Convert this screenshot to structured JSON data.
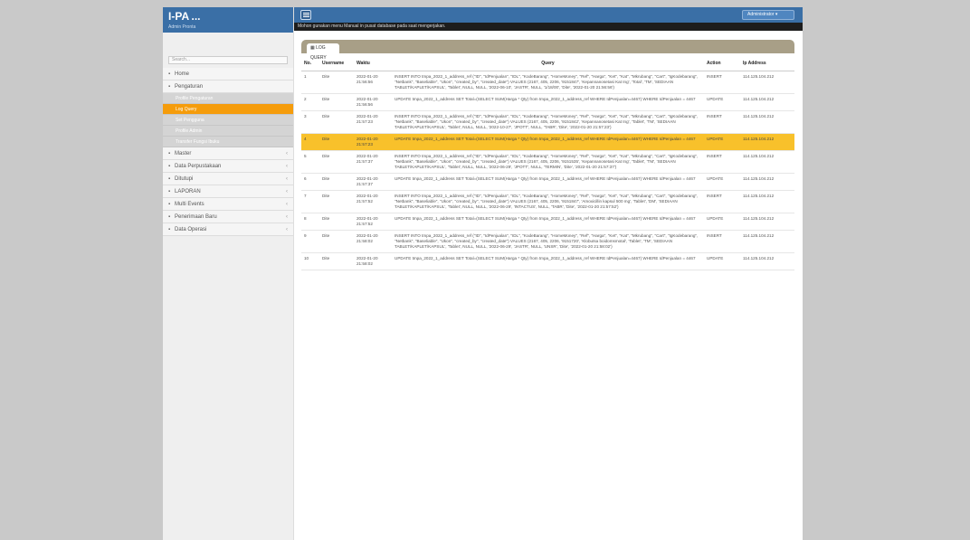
{
  "brand": {
    "title": "I-PA ...",
    "subtitle": "Admin Pronta"
  },
  "sidebar": {
    "search": "Search...",
    "items": [
      {
        "label": "Home",
        "icon": "home-icon",
        "chev": ""
      },
      {
        "label": "Pengaturan",
        "icon": "settings-icon",
        "chev": ""
      }
    ],
    "subitems": [
      {
        "label": "Profile Pengaturan",
        "active": false
      },
      {
        "label": "Log Query",
        "active": true
      },
      {
        "label": "Set Pengguna",
        "active": false
      },
      {
        "label": "Profile Admin",
        "active": false
      },
      {
        "label": "Transfer Fungsi Ibuku",
        "active": false
      }
    ],
    "items2": [
      {
        "label": "Master",
        "icon": "folder-icon",
        "chev": "‹"
      },
      {
        "label": "Data Perpustakaan",
        "icon": "folder-icon",
        "chev": "‹"
      },
      {
        "label": "Ditutupi",
        "icon": "folder-icon",
        "chev": "‹"
      },
      {
        "label": "LAPORAN",
        "icon": "folder-icon",
        "chev": "‹"
      },
      {
        "label": "Multi Events",
        "icon": "folder-icon",
        "chev": "‹"
      },
      {
        "label": "Penerimaan Baru",
        "icon": "folder-icon",
        "chev": "‹"
      },
      {
        "label": "Data Operasi",
        "icon": "folder-icon",
        "chev": "‹"
      }
    ]
  },
  "topbar": {
    "user": "Administrator"
  },
  "notice": "Mohon gunakan menu Manual in pusat database pada saat mengerjakan.",
  "tab": {
    "label": "LOG QUERY"
  },
  "table": {
    "headers": [
      "No.",
      "Username",
      "Waktu",
      "Query",
      "Action",
      "Ip Address"
    ],
    "rows": [
      {
        "no": "1",
        "user": "Dite",
        "time": "2022-01-20 21:56:56",
        "query": "INSERT INTO tmpa_2022_1_address_ref (\"ID\", \"IdPenjualan\", \"IDL\", \"KodeBarang\", \"HomeMoney\", \"Ref\", \"Harga\", \"Ket\", \"Kat\", \"Mkrubang\", \"Cart\", \"IgKodebarang\", \"Netbank\", \"Baseliable\", \"Ukon\", \"created_by\", \"created_date\") VALUES (2167, 405, 2206, '9151847', 'Kepannanosetasi Kat Ing', 'Total', 'TM', 'SEDIAAN TABLET/KAPLET/KAPSUL', 'Tablet', NULL, NULL, '2022-06-10', 'JASTR', NULL, '1/18/00', 'Dite', '2022-01-20 21:56:56')",
        "action": "INSERT",
        "ip": "114.125.104.212",
        "hl": false
      },
      {
        "no": "2",
        "user": "Dite",
        "time": "2022-01-20 21:56:56",
        "query": "UPDATE tmpa_2022_1_address SET Total=(SELECT SUM(Harga * Qty) from tmpa_2022_1_address_ref WHERE IdPenjualan=4467) WHERE IdPenjualan = 4467",
        "action": "UPDATE",
        "ip": "114.125.104.212",
        "hl": false
      },
      {
        "no": "3",
        "user": "Dite",
        "time": "2022-01-20 21:57:23",
        "query": "INSERT INTO tmpa_2022_1_address_ref (\"ID\", \"IdPenjualan\", \"IDL\", \"KodeBarang\", \"HomeMoney\", \"Ref\", \"Harga\", \"Ket\", \"Kat\", \"Mkrubang\", \"Cart\", \"IgKodebarang\", \"Netbank\", \"Baseliable\", \"Ukon\", \"created_by\", \"created_date\") VALUES (2167, 405, 2206, '9151842', 'Kepannanosetasi Kat Ing', 'Tablet', 'TM', 'SEDIAAN TABLET/KAPLET/KAPSUL', 'Tablet', NULL, NULL, '2022-10-27', 'JPOTT', NULL, 'TABR', 'Dite', '2022-01-20 21:57:23')",
        "action": "INSERT",
        "ip": "114.125.104.212",
        "hl": false
      },
      {
        "no": "4",
        "user": "Dite",
        "time": "2022-01-20 21:57:23",
        "query": "UPDATE tmpa_2022_1_address SET Total=(SELECT SUM(Harga * Qty) from tmpa_2022_1_address_ref WHERE IdPenjualan=4467) WHERE IdPenjualan = 4467",
        "action": "UPDATE",
        "ip": "114.125.104.212",
        "hl": true
      },
      {
        "no": "5",
        "user": "Dite",
        "time": "2022-01-20 21:57:37",
        "query": "INSERT INTO tmpa_2022_1_address_ref (\"ID\", \"IdPenjualan\", \"IDL\", \"KodeBarang\", \"HomeMoney\", \"Ref\", \"Harga\", \"Ket\", \"Kat\", \"Mkrubang\", \"Cart\", \"IgKodebarang\", \"Netbank\", \"Baseliable\", \"Ukon\", \"created_by\", \"created_date\") VALUES (2167, 405, 2206, '9151535', 'Kepannanosetasi Kat Ing', 'Tablet', 'TM', 'SEDIAAN TABLET/KAPLET/KAPSUL', 'Tablet', NULL, NULL, '2022-06-29', 'JPOTT', NULL, 'TERMIN', 'Dite', '2022-01-20 21:57:37')",
        "action": "INSERT",
        "ip": "114.125.104.212",
        "hl": false
      },
      {
        "no": "6",
        "user": "Dite",
        "time": "2022-01-20 21:57:37",
        "query": "UPDATE tmpa_2022_1_address SET Total=(SELECT SUM(Harga * Qty) from tmpa_2022_1_address_ref WHERE IdPenjualan=4467) WHERE IdPenjualan = 4467",
        "action": "UPDATE",
        "ip": "114.125.104.212",
        "hl": false
      },
      {
        "no": "7",
        "user": "Dite",
        "time": "2022-01-20 21:57:52",
        "query": "INSERT INTO tmpa_2022_1_address_ref (\"ID\", \"IdPenjualan\", \"IDL\", \"KodeBarang\", \"HomeMoney\", \"Ref\", \"Harga\", \"Ket\", \"Kat\", \"Mkrubang\", \"Cart\", \"IgKodebarang\", \"Netbank\", \"Baseliable\", \"Ukon\", \"created_by\", \"created_date\") VALUES (2167, 405, 2206, '9151847', 'Amoxicillin kapsul 500 mg', 'Tablet', 'DM', 'SEDIAAN TABLET/KAPLET/KAPSUL', 'Tablet', NULL, NULL, '2022-06-29', 'INTACTUS', NULL, 'TABR', 'Dite', '2022-01-20 21:57:52')",
        "action": "INSERT",
        "ip": "114.125.104.212",
        "hl": false
      },
      {
        "no": "8",
        "user": "Dite",
        "time": "2022-01-20 21:57:52",
        "query": "UPDATE tmpa_2022_1_address SET Total=(SELECT SUM(Harga * Qty) from tmpa_2022_1_address_ref WHERE IdPenjualan=4467) WHERE IdPenjualan = 4467",
        "action": "UPDATE",
        "ip": "114.125.104.212",
        "hl": false
      },
      {
        "no": "9",
        "user": "Dite",
        "time": "2022-01-20 21:58:02",
        "query": "INSERT INTO tmpa_2022_1_address_ref (\"ID\", \"IdPenjualan\", \"IDL\", \"KodeBarang\", \"HomeMoney\", \"Ref\", \"Harga\", \"Ket\", \"Kat\", \"Mkrubang\", \"Cart\", \"IgKodebarang\", \"Netbank\", \"Baseliable\", \"Ukon\", \"created_by\", \"created_date\") VALUES (2167, 405, 2206, '9151720', 'Klobutsa boidomsmotal', 'Tablet', 'TM', 'SEDIAAN TABLET/KAPLET/KAPSUL', 'Tablet', NULL, NULL, '2022-06-29', 'JASTR', NULL, 'UNSR', 'Dite', '2022-01-20 21:58:02')",
        "action": "INSERT",
        "ip": "114.125.104.212",
        "hl": false
      },
      {
        "no": "10",
        "user": "Dite",
        "time": "2022-01-20 21:58:02",
        "query": "UPDATE tmpa_2022_1_address SET Total=(SELECT SUM(Harga * Qty) from tmpa_2022_1_address_ref WHERE IdPenjualan=4467) WHERE IdPenjualan = 4467",
        "action": "UPDATE",
        "ip": "114.125.104.212",
        "hl": false
      }
    ]
  }
}
